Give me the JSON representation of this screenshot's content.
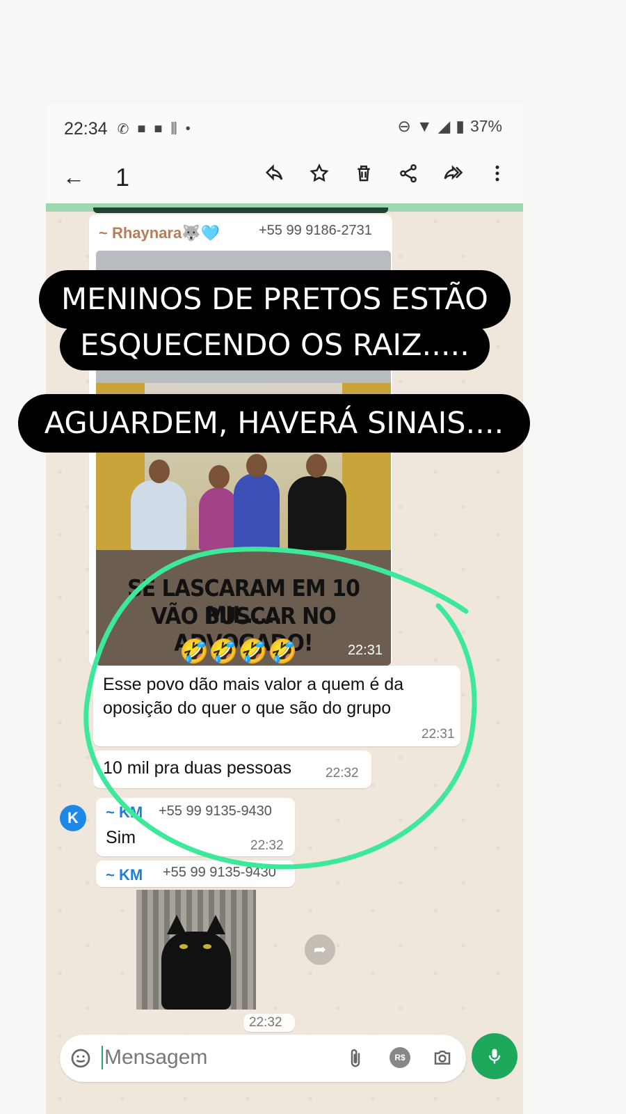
{
  "status_bar": {
    "time": "22:34",
    "battery": "37%"
  },
  "app_bar": {
    "selected_count": "1"
  },
  "messages": {
    "first": {
      "sender": "~ Rhaynara🐺🩵",
      "phone": "+55 99 9186-2731",
      "image_time": "22:31"
    },
    "image_caption_line1": "SE LASCARAM EM 10 MIL.....",
    "image_caption_line2": "VÃO BUSCAR NO ADVOGADO!",
    "image_emojis": "🤣🤣🤣🤣",
    "m2": {
      "text_line1": "Esse povo dão mais valor a quem é da",
      "text_line2": "oposição do quer o que são do grupo",
      "time": "22:31"
    },
    "m3": {
      "text": "10 mil pra duas pessoas",
      "time": "22:32"
    },
    "m4": {
      "avatar_letter": "K",
      "sender": "~ KM",
      "phone": "+55 99 9135-9430",
      "text": "Sim",
      "time": "22:32"
    },
    "m5": {
      "sender": "~ KM",
      "phone": "+55 99 9135-9430",
      "time": "22:32"
    }
  },
  "input": {
    "placeholder": "Mensagem",
    "currency_label": "R$"
  },
  "overlay": {
    "line1": "MENINOS DE PRETOS ESTÃO",
    "line2": "ESQUECENDO OS RAIZ.....",
    "line3": "AGUARDEM, HAVERÁ SINAIS...."
  },
  "colors": {
    "accent_green": "#1ea85b",
    "highlight": "#3ee89a",
    "sender_rhaynara": "#b57d5a",
    "sender_km": "#1e7fd6"
  }
}
